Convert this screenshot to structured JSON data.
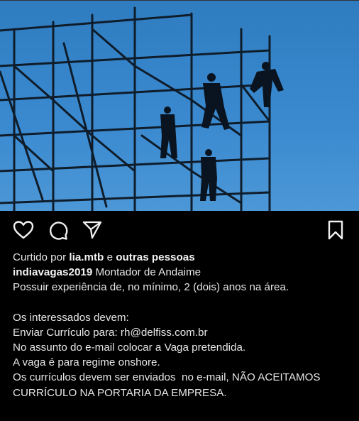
{
  "post": {
    "image": {
      "subject": "scaffold-workers-photo",
      "sky_color": "#3b86c6"
    },
    "actions": {
      "like_icon": "heart-icon",
      "comment_icon": "comment-icon",
      "share_icon": "send-icon",
      "save_icon": "bookmark-icon"
    },
    "likes": {
      "prefix": "Curtido por",
      "user": "lia.mtb",
      "conj": "e",
      "others": "outras pessoas"
    },
    "caption": {
      "author": "indiavagas2019",
      "title": "Montador de Andaime",
      "lines": [
        "Possuir experiência de, no mínimo, 2 (dois) anos na área.",
        "",
        "Os interessados devem:",
        "Enviar Currículo para: rh@delfiss.com.br",
        "No assunto do e-mail colocar a Vaga pretendida.",
        "A vaga é para regime onshore.",
        "Os currículos devem ser enviados  no e-mail, NÃO ACEITAMOS",
        "CURRÍCULO NA PORTARIA DA EMPRESA."
      ]
    }
  }
}
